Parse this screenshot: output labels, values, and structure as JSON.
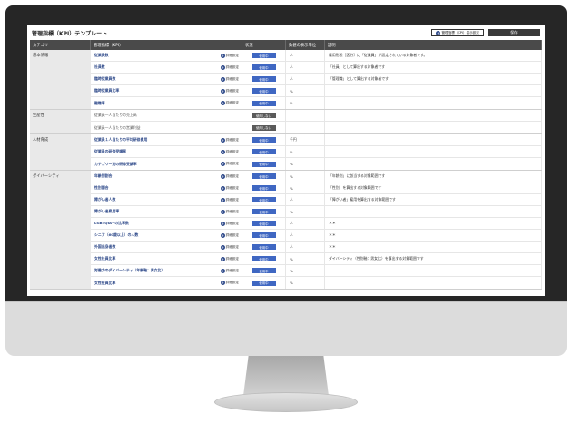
{
  "page": {
    "title": "管理指標（KPI）テンプレート",
    "button_kpi_settings": "管理指標（KPI）表示設定",
    "button_save": "保存",
    "plus_glyph": "+",
    "columns": [
      "カテゴリ",
      "管理指標（KPI）",
      "状況",
      "数値の表示単位",
      "説明"
    ],
    "detail_label": "詳細設定"
  },
  "groups": [
    {
      "category": "基本情報",
      "rows": [
        {
          "name": "従業員数",
          "link": "詳細設定",
          "status": "使用中",
          "status_type": "on",
          "unit": "人",
          "desc": "雇用形態［区分］に「従業員」が設定されている対象者です。"
        },
        {
          "name": "社員数",
          "link": "詳細設定",
          "status": "使用中",
          "status_type": "on",
          "unit": "人",
          "desc": "「社員」として算出する対象者です"
        },
        {
          "name": "臨時従業員数",
          "link": "詳細設定",
          "status": "使用中",
          "status_type": "on",
          "unit": "人",
          "desc": "「管理職」として算出する対象者です"
        },
        {
          "name": "臨時従業員比率",
          "link": "詳細設定",
          "status": "使用中",
          "status_type": "on",
          "unit": "%",
          "desc": ""
        },
        {
          "name": "離職率",
          "link": "詳細設定",
          "status": "使用中",
          "status_type": "on",
          "unit": "%",
          "desc": ""
        }
      ]
    },
    {
      "category": "生産性",
      "rows": [
        {
          "name": "従業員一人当たりの売上高",
          "plain": true,
          "link": "",
          "status": "使用しない",
          "status_type": "off",
          "unit": "",
          "desc": ""
        },
        {
          "name": "従業員一人当たりの営業利益",
          "plain": true,
          "link": "",
          "status": "使用しない",
          "status_type": "off",
          "unit": "",
          "desc": ""
        }
      ]
    },
    {
      "category": "人材育成",
      "rows": [
        {
          "name": "従業員１人当たりの平均研修費用",
          "link": "詳細設定",
          "status": "使用中",
          "status_type": "on",
          "unit": "千円",
          "desc": ""
        },
        {
          "name": "従業員の研修受講率",
          "link": "詳細設定",
          "status": "使用中",
          "status_type": "on",
          "unit": "%",
          "desc": ""
        },
        {
          "name": "カテゴリー別の研修受講率",
          "link": "詳細設定",
          "status": "使用中",
          "status_type": "on",
          "unit": "%",
          "desc": ""
        }
      ]
    },
    {
      "category": "ダイバーシティ",
      "rows": [
        {
          "name": "年齢別割合",
          "link": "詳細設定",
          "status": "使用中",
          "status_type": "on",
          "unit": "%",
          "desc": "「年齢別」に該当する対象範囲です"
        },
        {
          "name": "性別割合",
          "link": "詳細設定",
          "status": "使用中",
          "status_type": "on",
          "unit": "%",
          "desc": "「性別」を算出する対象範囲です"
        },
        {
          "name": "障がい者人数",
          "link": "詳細設定",
          "status": "使用中",
          "status_type": "on",
          "unit": "人",
          "desc": "「障がい者」雇用を算出する対象範囲です"
        },
        {
          "name": "障がい者雇用率",
          "link": "詳細設定",
          "status": "使用中",
          "status_type": "on",
          "unit": "%",
          "desc": ""
        },
        {
          "name": "LGBTQIA+の比率数",
          "link": "詳細設定",
          "status": "使用中",
          "status_type": "on",
          "unit": "人",
          "desc": "＊＊"
        },
        {
          "name": "シニア（60歳以上）の人数",
          "link": "詳細設定",
          "status": "使用中",
          "status_type": "on",
          "unit": "人",
          "desc": "＊＊"
        },
        {
          "name": "外国出身者数",
          "link": "詳細設定",
          "status": "使用中",
          "status_type": "on",
          "unit": "人",
          "desc": "＊＊"
        },
        {
          "name": "女性社員比率",
          "link": "詳細設定",
          "status": "使用中",
          "status_type": "on",
          "unit": "%",
          "desc": "ダイバーシティ（性別軸：男女比）を算出する対象範囲です"
        },
        {
          "name": "労働力のダイバーシティ（年齢軸：男女比）",
          "link": "詳細設定",
          "status": "使用中",
          "status_type": "on",
          "unit": "%",
          "desc": ""
        },
        {
          "name": "女性役員比率",
          "link": "詳細設定",
          "status": "使用中",
          "status_type": "on",
          "unit": "%",
          "desc": ""
        }
      ]
    }
  ]
}
